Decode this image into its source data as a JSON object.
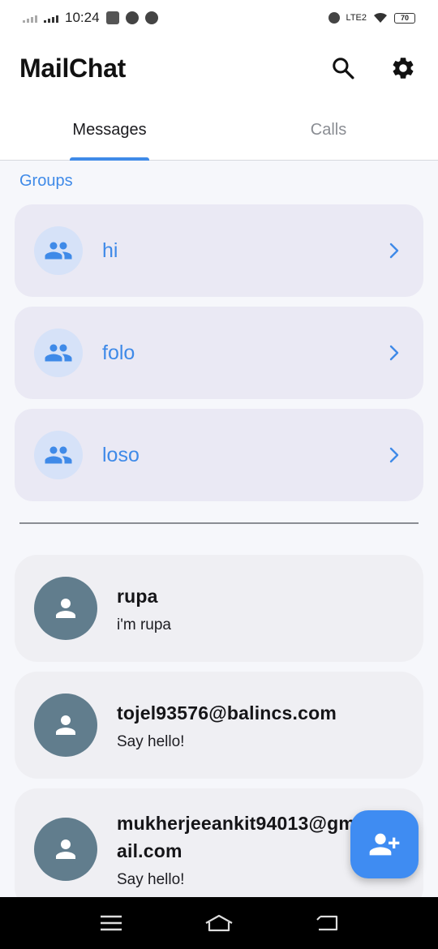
{
  "status_bar": {
    "time": "10:24",
    "battery": "70",
    "network_label": "LTE2"
  },
  "app_bar": {
    "title": "MailChat",
    "search_icon": "search-icon",
    "settings_icon": "gear-icon"
  },
  "tabs": [
    {
      "label": "Messages",
      "active": true
    },
    {
      "label": "Calls",
      "active": false
    }
  ],
  "groups": {
    "label": "Groups",
    "items": [
      {
        "name": "hi",
        "icon": "group-icon"
      },
      {
        "name": "folo",
        "icon": "group-icon"
      },
      {
        "name": "loso",
        "icon": "group-icon"
      }
    ]
  },
  "contacts": [
    {
      "name": "rupa",
      "subtitle": "i'm rupa",
      "icon": "person-icon"
    },
    {
      "name": "tojel93576@balincs.com",
      "subtitle": "Say hello!",
      "icon": "person-icon"
    },
    {
      "name": "mukherjeeankit94013@gmail.com",
      "subtitle": "Say hello!",
      "icon": "person-icon"
    }
  ],
  "fab": {
    "icon": "add-contact-icon"
  },
  "colors": {
    "accent": "#3f8ae8",
    "group_card": "#eae9f4",
    "contact_card": "#efeff3",
    "contact_avatar": "#617d8d"
  }
}
